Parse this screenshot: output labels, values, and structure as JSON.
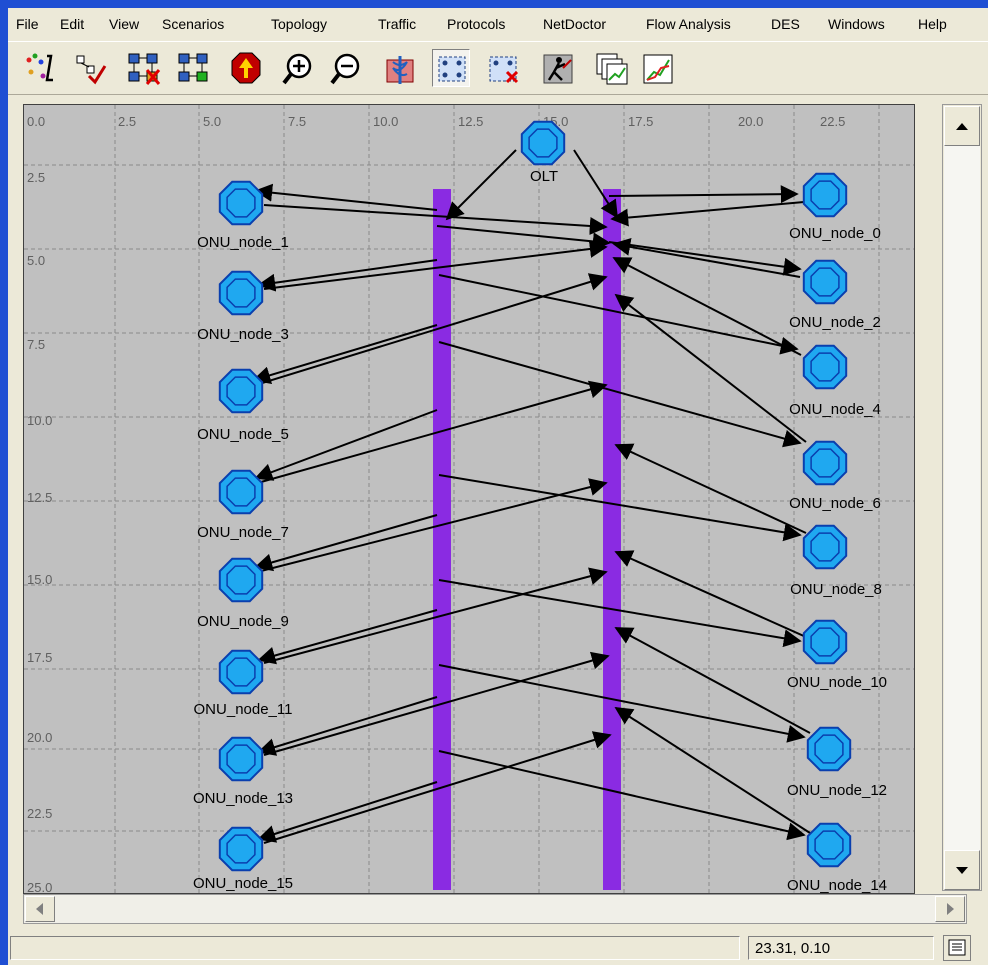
{
  "menu": [
    "File",
    "Edit",
    "View",
    "Scenarios",
    "Topology",
    "Traffic",
    "Protocols",
    "NetDoctor",
    "Flow Analysis",
    "DES",
    "Windows",
    "Help"
  ],
  "toolbar": [
    {
      "name": "rapid-configuration-icon"
    },
    {
      "name": "verify-links-icon"
    },
    {
      "name": "fail-selected-icon"
    },
    {
      "name": "recover-selected-icon"
    },
    {
      "name": "return-to-parent-icon"
    },
    {
      "name": "zoom-in-icon"
    },
    {
      "name": "zoom-out-icon"
    },
    {
      "name": "netdoctor-icon"
    },
    {
      "name": "configure-simulation-icon"
    },
    {
      "name": "delete-simulation-icon"
    },
    {
      "name": "run-simulation-icon"
    },
    {
      "name": "view-results-icon"
    },
    {
      "name": "results-graph-icon"
    }
  ],
  "grid": {
    "x_ticks": [
      "0.0",
      "2.5",
      "5.0",
      "7.5",
      "10.0",
      "12.5",
      "15.0",
      "17.5",
      "20.0",
      "22.5"
    ],
    "y_ticks": [
      "2.5",
      "5.0",
      "7.5",
      "10.0",
      "12.5",
      "15.0",
      "17.5",
      "20.0",
      "22.5",
      "25.0"
    ]
  },
  "colors": {
    "node": "#1fa8f0",
    "node_outline": "#0a3fae",
    "bus": "#8a2be2",
    "canvas": "#c0c0c0",
    "links": "#000000"
  },
  "nodes": [
    {
      "id": "OLT",
      "label": "OLT"
    },
    {
      "id": "n0",
      "label": "ONU_node_0"
    },
    {
      "id": "n1",
      "label": "ONU_node_1"
    },
    {
      "id": "n2",
      "label": "ONU_node_2"
    },
    {
      "id": "n3",
      "label": "ONU_node_3"
    },
    {
      "id": "n4",
      "label": "ONU_node_4"
    },
    {
      "id": "n5",
      "label": "ONU_node_5"
    },
    {
      "id": "n6",
      "label": "ONU_node_6"
    },
    {
      "id": "n7",
      "label": "ONU_node_7"
    },
    {
      "id": "n8",
      "label": "ONU_node_8"
    },
    {
      "id": "n9",
      "label": "ONU_node_9"
    },
    {
      "id": "n10",
      "label": "ONU_node_10"
    },
    {
      "id": "n11",
      "label": "ONU_node_11"
    },
    {
      "id": "n12",
      "label": "ONU_node_12"
    },
    {
      "id": "n13",
      "label": "ONU_node_13"
    },
    {
      "id": "n14",
      "label": "ONU_node_14"
    },
    {
      "id": "n15",
      "label": "ONU_node_15"
    }
  ],
  "buses": [
    {
      "id": "bus-left"
    },
    {
      "id": "bus-right"
    }
  ],
  "status": {
    "coords": "23.31, 0.10"
  }
}
